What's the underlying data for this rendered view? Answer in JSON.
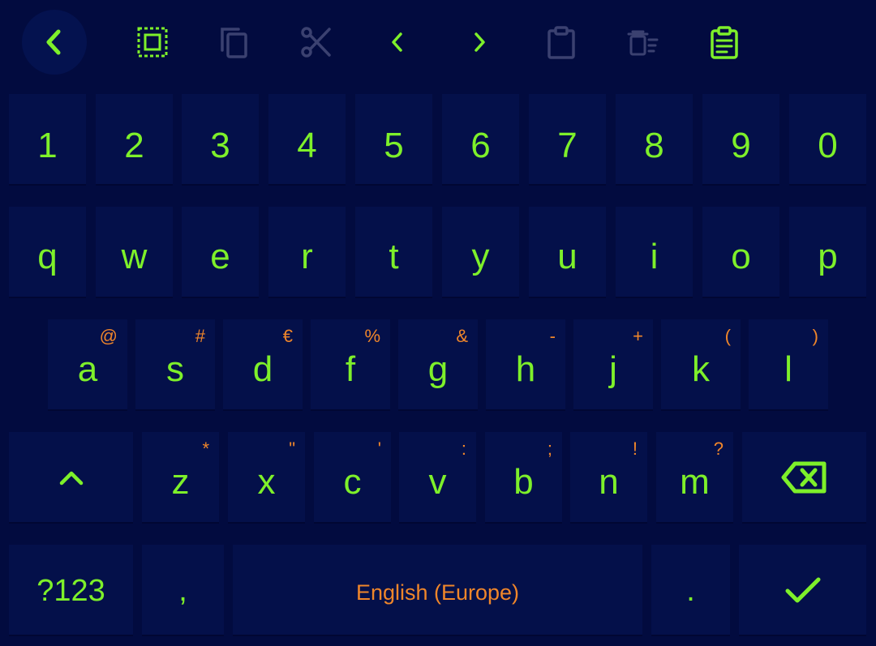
{
  "toolbar": {
    "items": [
      {
        "name": "back",
        "icon": "chevron-left-icon",
        "enabled": true
      },
      {
        "name": "select-all",
        "icon": "select-all-icon",
        "enabled": true
      },
      {
        "name": "copy",
        "icon": "copy-icon",
        "enabled": false
      },
      {
        "name": "cut",
        "icon": "scissors-icon",
        "enabled": false
      },
      {
        "name": "cursor-left",
        "icon": "chevron-left-icon",
        "enabled": true
      },
      {
        "name": "cursor-right",
        "icon": "chevron-right-icon",
        "enabled": true
      },
      {
        "name": "paste",
        "icon": "clipboard-icon",
        "enabled": false
      },
      {
        "name": "clear-clipboard",
        "icon": "clear-all-icon",
        "enabled": false
      },
      {
        "name": "clipboard-history",
        "icon": "clipboard-list-icon",
        "enabled": true
      }
    ]
  },
  "keyboard": {
    "numbers": [
      "1",
      "2",
      "3",
      "4",
      "5",
      "6",
      "7",
      "8",
      "9",
      "0"
    ],
    "row_q": [
      "q",
      "w",
      "e",
      "r",
      "t",
      "y",
      "u",
      "i",
      "o",
      "p"
    ],
    "row_a": [
      {
        "key": "a",
        "hint": "@"
      },
      {
        "key": "s",
        "hint": "#"
      },
      {
        "key": "d",
        "hint": "€"
      },
      {
        "key": "f",
        "hint": "%"
      },
      {
        "key": "g",
        "hint": "&"
      },
      {
        "key": "h",
        "hint": "-"
      },
      {
        "key": "j",
        "hint": "+"
      },
      {
        "key": "k",
        "hint": "("
      },
      {
        "key": "l",
        "hint": ")"
      }
    ],
    "row_z": [
      {
        "key": "z",
        "hint": "*"
      },
      {
        "key": "x",
        "hint": "\""
      },
      {
        "key": "c",
        "hint": "'"
      },
      {
        "key": "v",
        "hint": ":"
      },
      {
        "key": "b",
        "hint": ";"
      },
      {
        "key": "n",
        "hint": "!"
      },
      {
        "key": "m",
        "hint": "?"
      }
    ],
    "shift_icon": "shift-caret-icon",
    "backspace_icon": "backspace-icon",
    "symbols_label": "?123",
    "comma_label": ",",
    "space_label": "English (Europe)",
    "period_label": ".",
    "enter_icon": "checkmark-icon"
  },
  "colors": {
    "background": "#020b3f",
    "key_background": "#04104a",
    "accent": "#7ef02a",
    "hint": "#f0862a",
    "disabled": "#3b4170"
  }
}
